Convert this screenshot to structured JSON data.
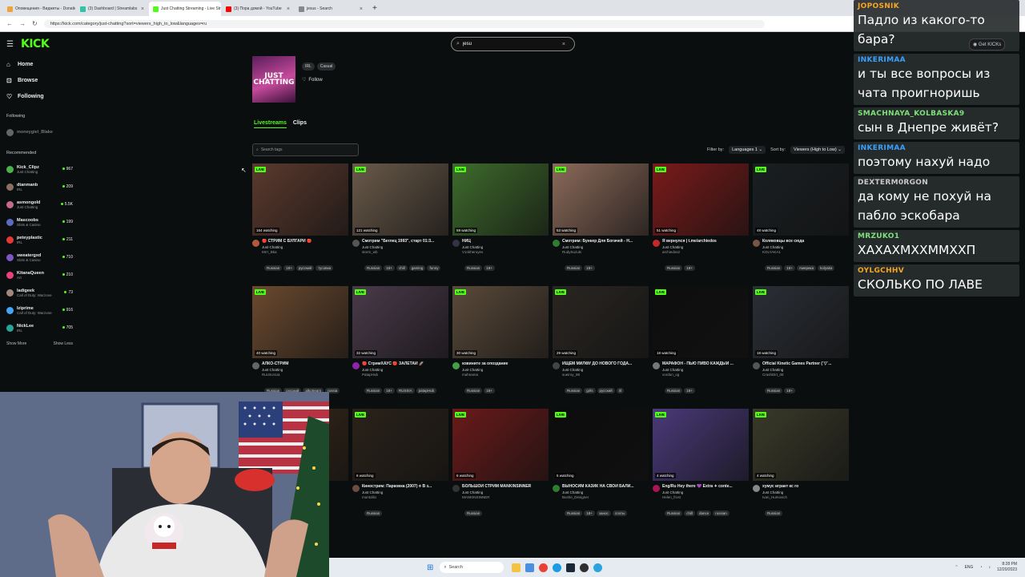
{
  "browser": {
    "tabs": [
      {
        "title": "Оповещения - Виджеты - Donatio",
        "color": "#f0a33c",
        "active": false
      },
      {
        "title": "(3) Dashboard | Streamlabs",
        "color": "#31c3a2",
        "active": false
      },
      {
        "title": "Just Chatting Streaming - Live Stre",
        "color": "#53fc18",
        "active": true
      },
      {
        "title": "(3) Пора домой - YouTube",
        "color": "#ff0000",
        "active": false
      },
      {
        "title": "jesus - Search",
        "color": "#888888",
        "active": false
      }
    ],
    "new_tab": "+",
    "url": "https://kick.com/category/just-chatting?sort=viewers_high_to_low&languages=ru"
  },
  "kick": {
    "logo": "KICK",
    "search_value": "jesu",
    "get_kicks": "Get KICKs",
    "nav": [
      {
        "label": "Home",
        "icon": "⌂"
      },
      {
        "label": "Browse",
        "icon": "⊡"
      },
      {
        "label": "Following",
        "icon": "♡"
      }
    ],
    "following_heading": "Following",
    "following": [
      {
        "name": "moneygiel_Blake",
        "color": "#666666"
      }
    ],
    "recommended_heading": "Recommended",
    "recommended": [
      {
        "name": "Kick_Clipz",
        "category": "Just Chatting",
        "viewers": "967",
        "color": "#4caf50"
      },
      {
        "name": "dtanmanb",
        "category": "IRL",
        "viewers": "209",
        "color": "#8d6e63"
      },
      {
        "name": "asmongold",
        "category": "Just Chatting",
        "viewers": "5.5K",
        "color": "#c46b8a"
      },
      {
        "name": "Mascoobs",
        "category": "Slots & Casino",
        "viewers": "199",
        "color": "#5c6bc0"
      },
      {
        "name": "peteyplastic",
        "category": "IRL",
        "viewers": "211",
        "color": "#e53935"
      },
      {
        "name": "sweatergxd",
        "category": "Slots & Casino",
        "viewers": "710",
        "color": "#7e57c2"
      },
      {
        "name": "KitanaQueen",
        "category": "Art",
        "viewers": "210",
        "color": "#ec407a"
      },
      {
        "name": "ladigeek",
        "category": "Call of Duty: Warzone",
        "viewers": "73",
        "color": "#a1887f"
      },
      {
        "name": "Iziprime",
        "category": "Call of Duty: Warzone",
        "viewers": "916",
        "color": "#42a5f5"
      },
      {
        "name": "NickLee",
        "category": "IRL",
        "viewers": "705",
        "color": "#26a69a"
      }
    ],
    "show_more": "Show More",
    "show_less": "Show Less",
    "category": {
      "image_text": "JUST CHATTING",
      "tags": [
        "IRL",
        "Casual"
      ],
      "follow": "Follow"
    },
    "tabs": [
      "Livestreams",
      "Clips"
    ],
    "search_tags_placeholder": "Search tags",
    "filter_by": "Filter by:",
    "languages": "Languages",
    "languages_count": "1",
    "sort_by": "Sort by:",
    "sort_value": "Viewers (High to Low)",
    "live_label": "LIVE",
    "streams": [
      {
        "title": "🔴 СТРИМ С БУЛГАРИ 🔴",
        "category": "Just Chatting",
        "user": "Mrrr_Bka",
        "watching": "164 watching",
        "tags": [
          "Russian",
          "18+",
          "русский",
          "тусовка"
        ],
        "bg": "#5b3a2e",
        "av": "#b05a3a"
      },
      {
        "title": "Смотрим \"Беглец 1993\", старт 01:3...",
        "category": "Just Chatting",
        "user": "storm_wb",
        "watching": "121 watching",
        "tags": [
          "Russian",
          "18+",
          "chill",
          "gaming",
          "funny"
        ],
        "bg": "#6a5a4a",
        "av": "#555"
      },
      {
        "title": "НИЦ",
        "category": "Just Chatting",
        "user": "V1nkheroyes",
        "watching": "59 watching",
        "tags": [
          "Russian",
          "18+"
        ],
        "bg": "#3e6b2c",
        "av": "#334"
      },
      {
        "title": "Смотрим: Бункер Для Богачей - Н...",
        "category": "Just Chatting",
        "user": "RudySuzuki",
        "watching": "53 watching",
        "tags": [
          "Russian",
          "18+"
        ],
        "bg": "#8b6a5a",
        "av": "#2e7d32"
      },
      {
        "title": "Я вернулся | t.me/archiedos",
        "category": "Just Chatting",
        "user": "archiedos2",
        "watching": "51 watching",
        "tags": [
          "Russian",
          "18+"
        ],
        "bg": "#7a1a1a",
        "av": "#c62828"
      },
      {
        "title": "Коляковцы все сюда",
        "category": "Just Chatting",
        "user": "KOLYAKA1",
        "watching": "48 watching",
        "tags": [
          "Russian",
          "18+",
          "Америка",
          "kolyaka"
        ],
        "bg": "#1a1f22",
        "av": "#795548"
      },
      {
        "title": "АЛКО-СТРИМ",
        "category": "Just Chatting",
        "user": "RuUsUsUa",
        "watching": "40 watching",
        "tags": [
          "Russian",
          "русский",
          "alkotream",
          "russia"
        ],
        "bg": "#6b4a2f",
        "av": "#666"
      },
      {
        "title": "🔴 СтримХАУС 🔴 ЗАЛЕТАЙ 🚀",
        "category": "Just Chatting",
        "user": "PatapHub",
        "watching": "32 watching",
        "tags": [
          "Russian",
          "18+",
          "RUSSIA",
          "patapHub"
        ],
        "bg": "#4a3a4a",
        "av": "#8e24aa"
      },
      {
        "title": "извините за опоздание",
        "category": "Just Chatting",
        "user": "mahnama",
        "watching": "30 watching",
        "tags": [
          "Russian",
          "18+"
        ],
        "bg": "#5a4a3a",
        "av": "#43a047"
      },
      {
        "title": "ИЩЕМ МИЛФУ ДО НОВОГО ГОДА...",
        "category": "Just Chatting",
        "user": "sueiroy_98",
        "watching": "29 watching",
        "tags": [
          "Russian",
          "girls",
          "русский",
          "irl"
        ],
        "bg": "#2a2622",
        "av": "#444"
      },
      {
        "title": "МАРАФОН - ПЬЮ ПИВО КАЖДЫЙ ...",
        "category": "Just Chatting",
        "user": "vordun_og",
        "watching": "18 watching",
        "tags": [
          "Russian",
          "18+"
        ],
        "bg": "#0e0e0e",
        "av": "#777"
      },
      {
        "title": "Official Kinetic Games Partner (ˉ▽ˉ...",
        "category": "Just Chatting",
        "user": "CrashDirt_08",
        "watching": "18 watching",
        "tags": [
          "Russian",
          "18+"
        ],
        "bg": "#2b2f36",
        "av": "#555"
      },
      {
        "title": "",
        "category": "",
        "user": "",
        "watching": "",
        "tags": [],
        "bg": "#3a2a1a",
        "av": "#333"
      },
      {
        "title": "Кинострим: Парковка (2007) ⟡ В з...",
        "category": "Just Chatting",
        "user": "montolilo",
        "watching": "6 watching",
        "tags": [
          "Russian"
        ],
        "bg": "#2a221a",
        "av": "#6d4c41"
      },
      {
        "title": "БОЛЬШОЙ СТРИМ MANKINSINNER",
        "category": "Just Chatting",
        "user": "MANKINSINNER",
        "watching": "6 watching",
        "tags": [
          "Russian"
        ],
        "bg": "#6a1a1a",
        "av": "#333"
      },
      {
        "title": "ВЫНОСИМ КАЗИК НА СВОЙ БАЛИ...",
        "category": "Just Chatting",
        "user": "Bushe_Designer",
        "watching": "5 watching",
        "tags": [
          "Russian",
          "18+",
          "заноc",
          "слоты"
        ],
        "bg": "#0c0c0c",
        "av": "#2e7d32"
      },
      {
        "title": "Eng/Ru Hey there 💜 Extra ✦ conte...",
        "category": "Just Chatting",
        "user": "Helen_frost",
        "watching": "4 watching",
        "tags": [
          "Russian",
          "chill",
          "dance",
          "russian"
        ],
        "bg": "#4a3a7a",
        "av": "#ad1457"
      },
      {
        "title": "хумус играет кс го",
        "category": "Just Chatting",
        "user": "Ivan_Humovich",
        "watching": "4 watching",
        "tags": [
          "Russian"
        ],
        "bg": "#3a3a2a",
        "av": "#888"
      }
    ]
  },
  "chat": [
    {
      "user": "JOPOSNIK",
      "color": "#f5a623",
      "text": "Падло из какого-то бара?"
    },
    {
      "user": "INKERIMAA",
      "color": "#3aa0ff",
      "text": "и ты все вопросы из чата проигноришь"
    },
    {
      "user": "SMACHNAYA_KOLBASKA9",
      "color": "#7ee07a",
      "text": "сын в Днепре живёт?"
    },
    {
      "user": "INKERIMAA",
      "color": "#3aa0ff",
      "text": "поэтому нахуй надо"
    },
    {
      "user": "DEXTERM0RGON",
      "color": "#c8c8c8",
      "text": "да кому не похуй на пабло эскобара"
    },
    {
      "user": "MRZUKO1",
      "color": "#7ee07a",
      "text": "ХАХАХМХХММХХП"
    },
    {
      "user": "OYLGCHHV",
      "color": "#f5a623",
      "text": "СКОЛЬКО ПО ЛАВЕ"
    }
  ],
  "taskbar": {
    "search_label": "Search",
    "lang": "ENG",
    "time": "8:28 PM",
    "date": "12/20/2023"
  }
}
